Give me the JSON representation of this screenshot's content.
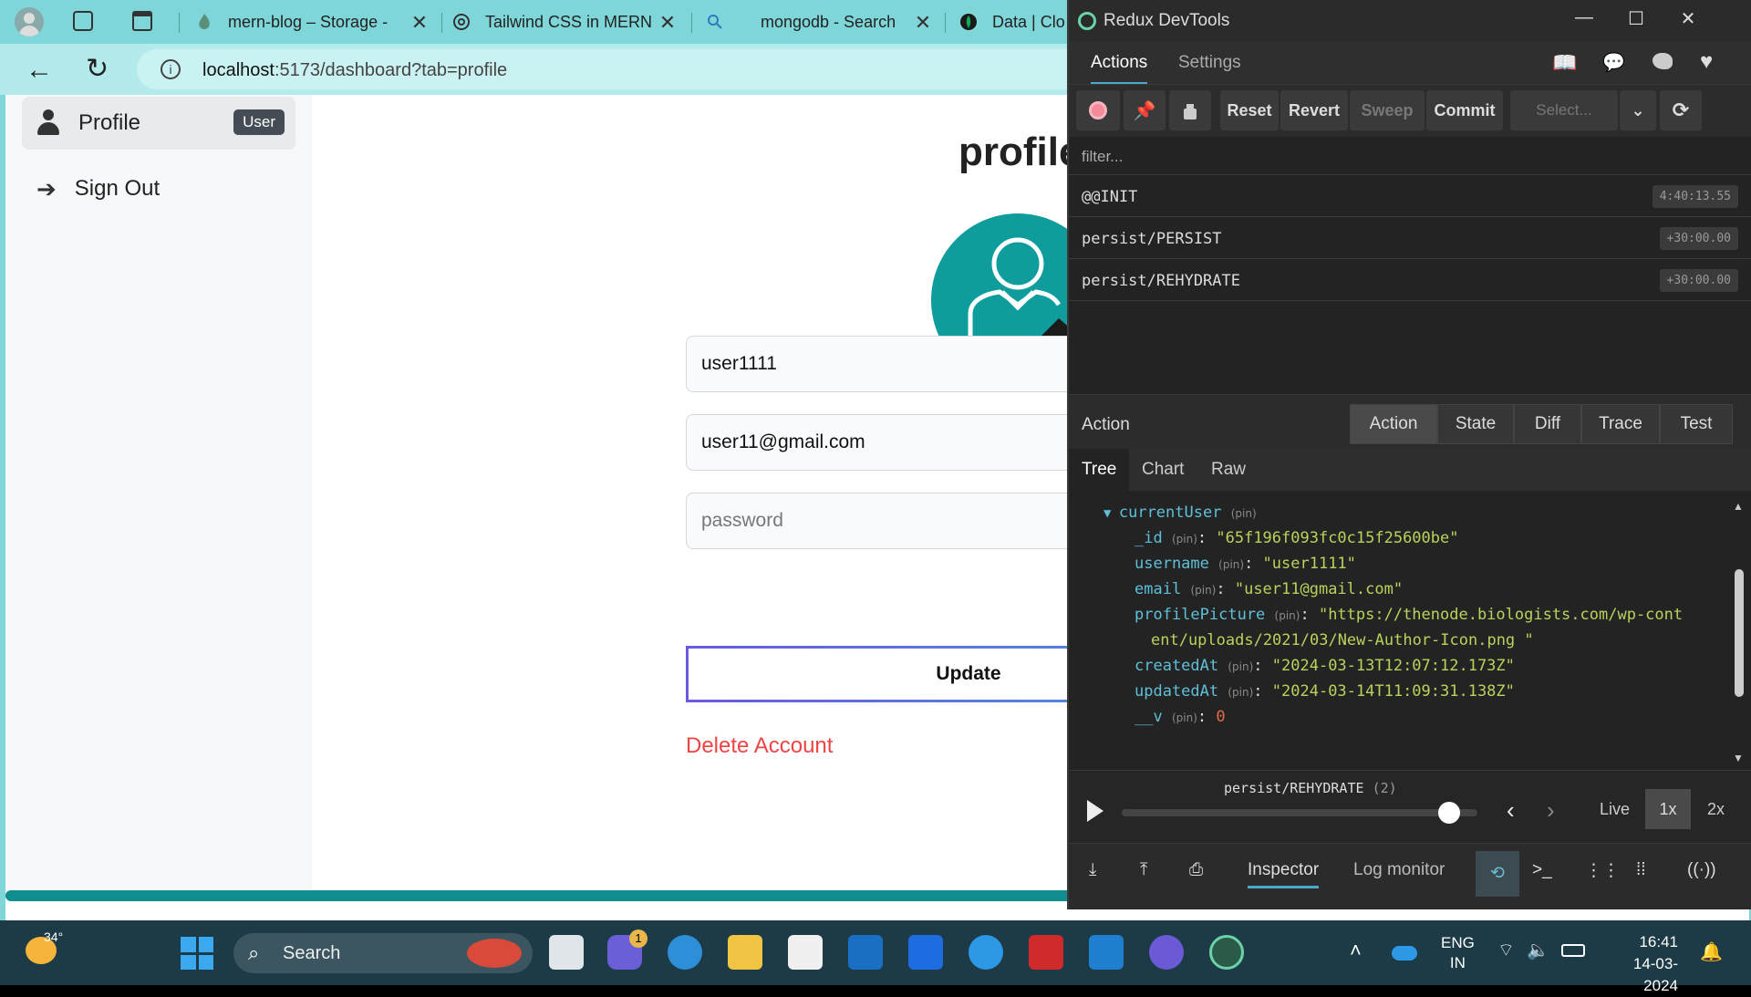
{
  "browser": {
    "tabs": [
      {
        "title": "mern-blog – Storage -",
        "icon": "flame-icon"
      },
      {
        "title": "Tailwind CSS in MERN",
        "icon": "chatgpt-icon"
      },
      {
        "title": "mongodb - Search",
        "icon": "search-icon"
      },
      {
        "title": "Data | Clo",
        "icon": "mongodb-leaf-icon"
      }
    ],
    "url": {
      "host": "localhost",
      "rest": ":5173/dashboard?tab=profile"
    }
  },
  "sidebar": {
    "items": [
      {
        "label": "Profile",
        "badge": "User",
        "icon": "person-icon"
      },
      {
        "label": "Sign Out",
        "icon": "arrow-right-icon"
      }
    ]
  },
  "profile": {
    "title": "profile",
    "username": "user1111",
    "email": "user11@gmail.com",
    "password_placeholder": "password",
    "update_label": "Update",
    "delete_label": "Delete Account"
  },
  "devtools": {
    "window_title": "Redux DevTools",
    "tabs": [
      "Actions",
      "Settings"
    ],
    "toolbar": {
      "reset": "Reset",
      "revert": "Revert",
      "sweep": "Sweep",
      "commit": "Commit",
      "select_placeholder": "Select..."
    },
    "filter_placeholder": "filter...",
    "actions": [
      {
        "name": "@@INIT",
        "time": "4:40:13.55"
      },
      {
        "name": "persist/PERSIST",
        "time": "+30:00.00"
      },
      {
        "name": "persist/REHYDRATE",
        "time": "+30:00.00"
      }
    ],
    "action_label": "Action",
    "view_tabs": [
      "Action",
      "State",
      "Diff",
      "Trace",
      "Test"
    ],
    "sub_tabs": [
      "Tree",
      "Chart",
      "Raw"
    ],
    "tree": {
      "root": "currentUser",
      "pin": "(pin)",
      "fields": [
        {
          "key": "_id",
          "value": "\"65f196f093fc0c15f25600be\""
        },
        {
          "key": "username",
          "value": "\"user1111\""
        },
        {
          "key": "email",
          "value": "\"user11@gmail.com\""
        },
        {
          "key": "profilePicture",
          "value": "\"https://thenode.biologists.com/wp-cont",
          "value2": "ent/uploads/2021/03/New-Author-Icon.png \""
        },
        {
          "key": "createdAt",
          "value": "\"2024-03-13T12:07:12.173Z\""
        },
        {
          "key": "updatedAt",
          "value": "\"2024-03-14T11:09:31.138Z\""
        },
        {
          "key": "__v",
          "value": "0"
        }
      ]
    },
    "slider_label": "persist/REHYDRATE",
    "slider_count": "(2)",
    "slider_value": 0.92,
    "speed": {
      "live": "Live",
      "one": "1x",
      "two": "2x"
    },
    "bottom": {
      "inspector": "Inspector",
      "log_monitor": "Log monitor"
    }
  },
  "taskbar": {
    "weather": "34°",
    "search": "Search",
    "teams_badge": "1",
    "lang1": "ENG",
    "lang2": "IN",
    "time": "16:41",
    "date": "14-03-2024"
  }
}
